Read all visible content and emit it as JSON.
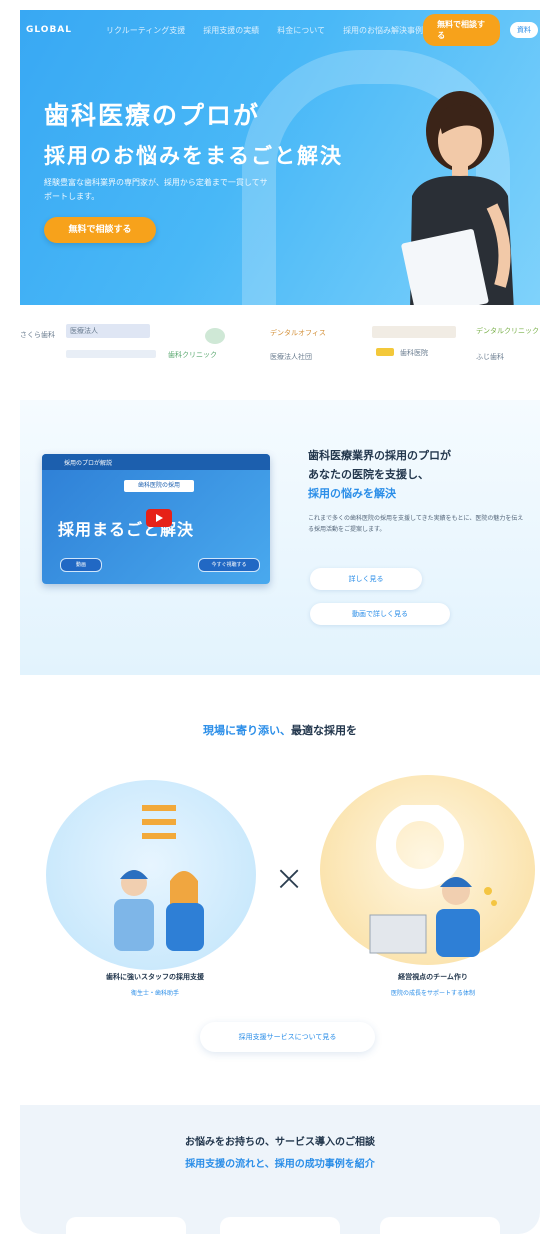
{
  "header": {
    "logo": "GLOBAL",
    "nav": [
      "リクルーティング支援",
      "採用支援の実績",
      "料金について",
      "採用のお悩み解決事例"
    ],
    "cta": "無料で相談する",
    "cta2": "資料"
  },
  "hero": {
    "title_line1": "歯科医療のプロが",
    "title_line2": "採用のお悩みをまるごと解決",
    "subtitle": "経験豊富な歯科業界の専門家が、採用から定着まで一貫してサポートします。",
    "cta": "無料で相談する"
  },
  "logos": {
    "items": [
      "医療法人",
      "歯科クリニック",
      "デンタルオフィス",
      "医療法人社団",
      "歯科医院",
      "デンタルクリニック",
      "ふじ歯科",
      "さくら歯科"
    ]
  },
  "video": {
    "thumb_bar": "採用のプロが解説",
    "thumb_tag": "歯科医院の採用",
    "thumb_big": "採用まるごと解決",
    "thumb_pill1": "動画",
    "thumb_pill2": "今すぐ視聴する",
    "title_line1": "歯科医療業界の採用のプロが",
    "title_line2": "あなたの医院を支援し、",
    "title_hl": "採用の悩みを解決",
    "desc": "これまで多くの歯科医院の採用を支援してきた実績をもとに、医院の魅力を伝える採用活動をご提案します。",
    "btn1": "詳しく見る",
    "btn2": "動画で詳しく見る"
  },
  "value": {
    "title_hl": "現場に寄り添い、",
    "title": "最適な採用を",
    "left_caption": "歯科に強いスタッフの採用支援",
    "left_sub": "衛生士・歯科助手",
    "right_caption": "経営視点のチーム作り",
    "right_sub": "医院の成長をサポートする体制",
    "more_btn": "採用支援サービスについて見る"
  },
  "bottom": {
    "line1": "お悩みをお持ちの、サービス導入のご相談",
    "line2": "採用支援の流れと、採用の成功事例を紹介"
  },
  "colors": {
    "accent": "#2b8ee8",
    "cta": "#f7a21b",
    "hero_start": "#38a8f3",
    "hero_end": "#7fd2fb"
  }
}
